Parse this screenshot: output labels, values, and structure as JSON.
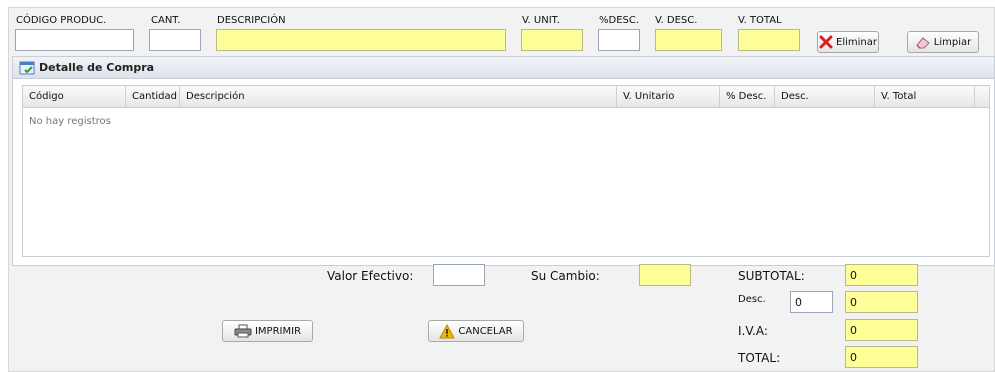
{
  "entry": {
    "labels": {
      "codigo": "CÓDIGO PRODUC.",
      "cant": "CANT.",
      "descripcion": "DESCRIPCIÓN",
      "vunit": "V. UNIT.",
      "pdesc": "%DESC.",
      "vdesc": "V. DESC.",
      "vtotal": "V. TOTAL"
    },
    "values": {
      "codigo": "",
      "cant": "",
      "descripcion": "",
      "vunit": "",
      "pdesc": "",
      "vdesc": "",
      "vtotal": ""
    },
    "buttons": {
      "eliminar": "Eliminar",
      "limpiar": "Limpiar"
    }
  },
  "panel": {
    "title": "Detalle de Compra",
    "columns": [
      "Código",
      "Cantidad",
      "Descripción",
      "V. Unitario",
      "% Desc.",
      "Desc.",
      "V. Total"
    ],
    "empty_text": "No hay registros"
  },
  "payment": {
    "valor_efectivo_label": "Valor Efectivo:",
    "valor_efectivo_value": "",
    "su_cambio_label": "Su Cambio:",
    "su_cambio_value": ""
  },
  "totals": {
    "subtotal_label": "SUBTOTAL:",
    "subtotal_value": "0",
    "desc_label": "Desc.",
    "desc_pct_value": "0",
    "desc_value": "0",
    "iva_label": "I.V.A:",
    "iva_value": "0",
    "total_label": "TOTAL:",
    "total_value": "0"
  },
  "actions": {
    "imprimir": "IMPRIMIR",
    "cancelar": "CANCELAR"
  },
  "colors": {
    "field_yellow": "#ffff99",
    "eliminar_icon": "#d62020",
    "warning_icon": "#f2b705"
  },
  "icons": [
    "close-icon",
    "eraser-icon",
    "table-icon",
    "printer-icon",
    "warning-icon"
  ]
}
